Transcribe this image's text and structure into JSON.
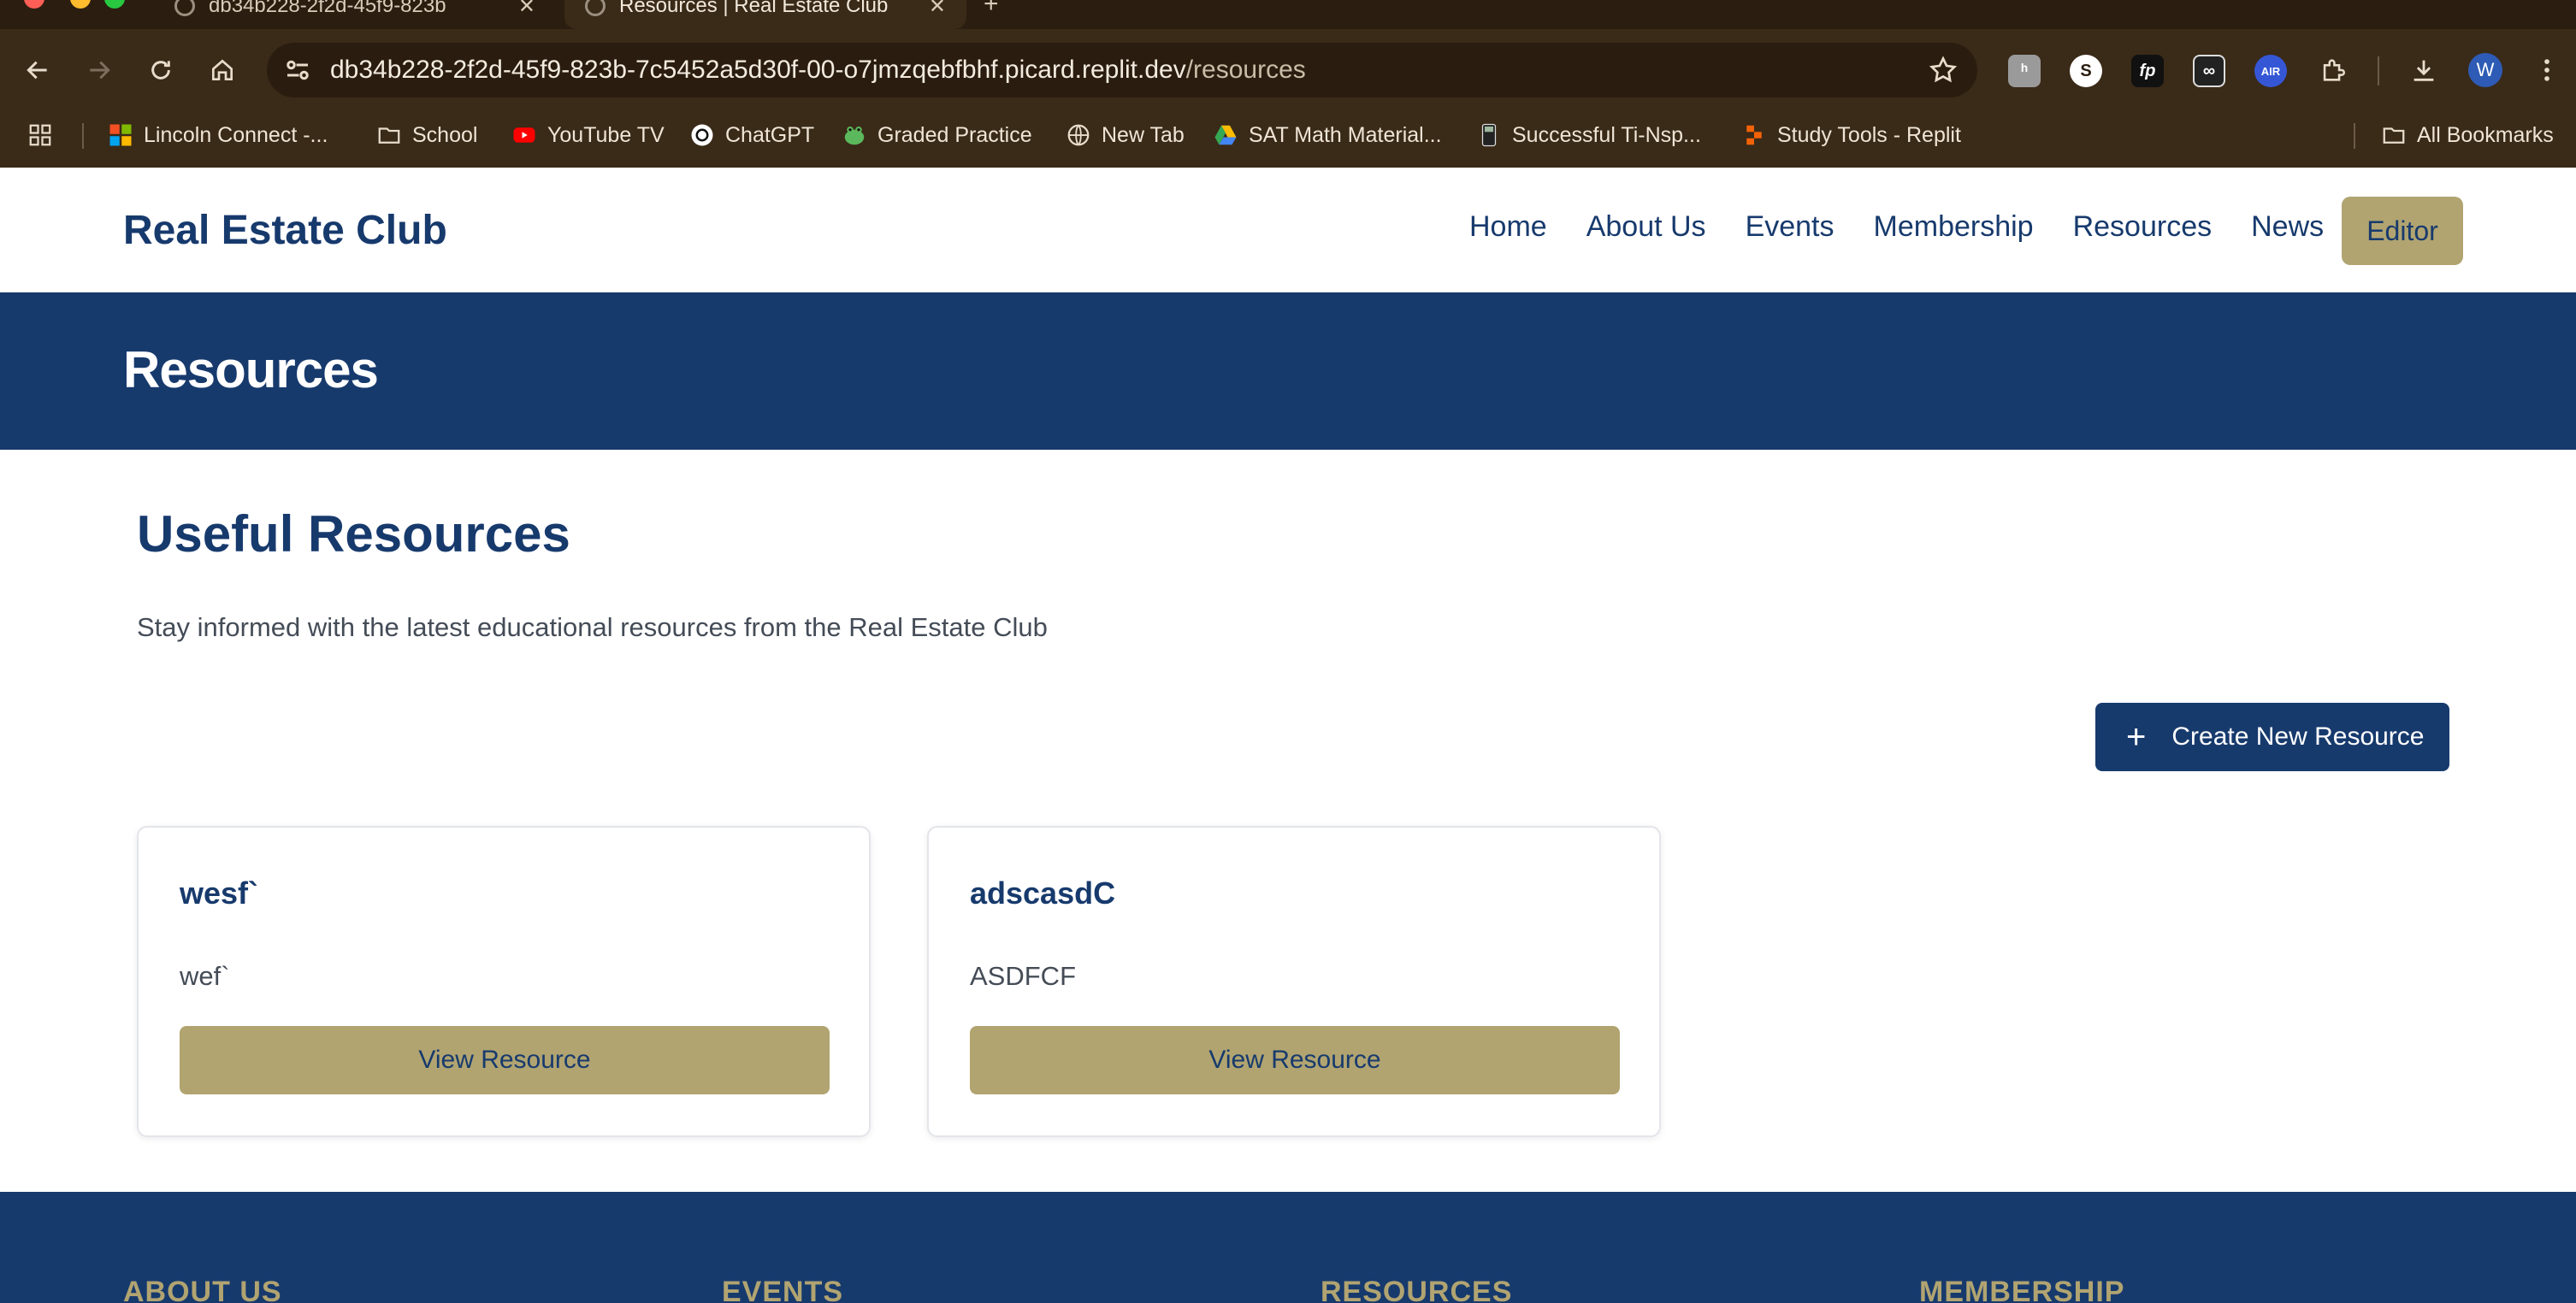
{
  "browser": {
    "tabs": [
      {
        "title": "db34b228-2f2d-45f9-823b",
        "active": false
      },
      {
        "title": "Resources | Real Estate Club",
        "active": true
      }
    ],
    "url_host": "db34b228-2f2d-45f9-823b-7c5452a5d30f-00-o7jmzqebfbhf.picard.replit.dev",
    "url_path": "/resources",
    "extensions": [
      "extension-1",
      "extension-s",
      "fp",
      "extension-glasses",
      "AIR"
    ],
    "profile_initial": "W",
    "bookmarks": [
      "Lincoln Connect -...",
      "School",
      "YouTube TV",
      "ChatGPT",
      "Graded Practice",
      "New Tab",
      "SAT Math Material...",
      "Successful Ti-Nsp...",
      "Study Tools - Replit"
    ],
    "all_bookmarks": "All Bookmarks"
  },
  "site": {
    "logo": "Real Estate Club",
    "nav": [
      "Home",
      "About Us",
      "Events",
      "Membership",
      "Resources",
      "News"
    ],
    "editor_label": "Editor",
    "page_title": "Resources"
  },
  "content": {
    "title": "Useful Resources",
    "subtitle": "Stay informed with the latest educational resources from the Real Estate Club",
    "create_label": "Create New Resource",
    "cards": [
      {
        "title": "wesf`",
        "description": "wef`",
        "button": "View Resource"
      },
      {
        "title": "adscasdC",
        "description": "ASDFCF",
        "button": "View Resource"
      }
    ]
  },
  "footer": {
    "columns": [
      "ABOUT US",
      "EVENTS",
      "RESOURCES",
      "MEMBERSHIP"
    ]
  },
  "colors": {
    "navy": "#173a6d",
    "gold": "#b1a471",
    "chrome_bg": "#3a2a18"
  }
}
